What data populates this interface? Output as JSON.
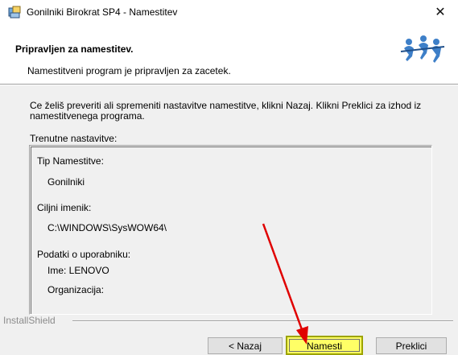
{
  "window": {
    "title": "Gonilniki Birokrat SP4 - Namestitev",
    "close_glyph": "✕",
    "icon": "installer-icon"
  },
  "header": {
    "title": "Pripravljen za namestitev.",
    "subtitle": "Namestitveni program je pripravljen za zacetek.",
    "logo": "installshield-logo"
  },
  "main": {
    "intro": "Ce želiš preveriti ali spremeniti nastavitve namestitve, klikni Nazaj. Klikni Preklici za izhod iz namestitvenega programa.",
    "current_settings_label": "Trenutne nastavitve:",
    "settings": {
      "install_type_label": "Tip Namestitve:",
      "install_type_value": "Gonilniki",
      "target_dir_label": "Ciljni imenik:",
      "target_dir_value": "C:\\WINDOWS\\SysWOW64\\",
      "user_info_label": "Podatki o uporabniku:",
      "user_name": "Ime: LENOVO",
      "organization": "Organizacija:"
    }
  },
  "footer": {
    "brand": "InstallShield",
    "back_label": "< Nazaj",
    "install_label": "Namesti",
    "cancel_label": "Preklici"
  },
  "annotation": {
    "arrow_color": "#e00000",
    "highlight_color": "#ffff66"
  }
}
